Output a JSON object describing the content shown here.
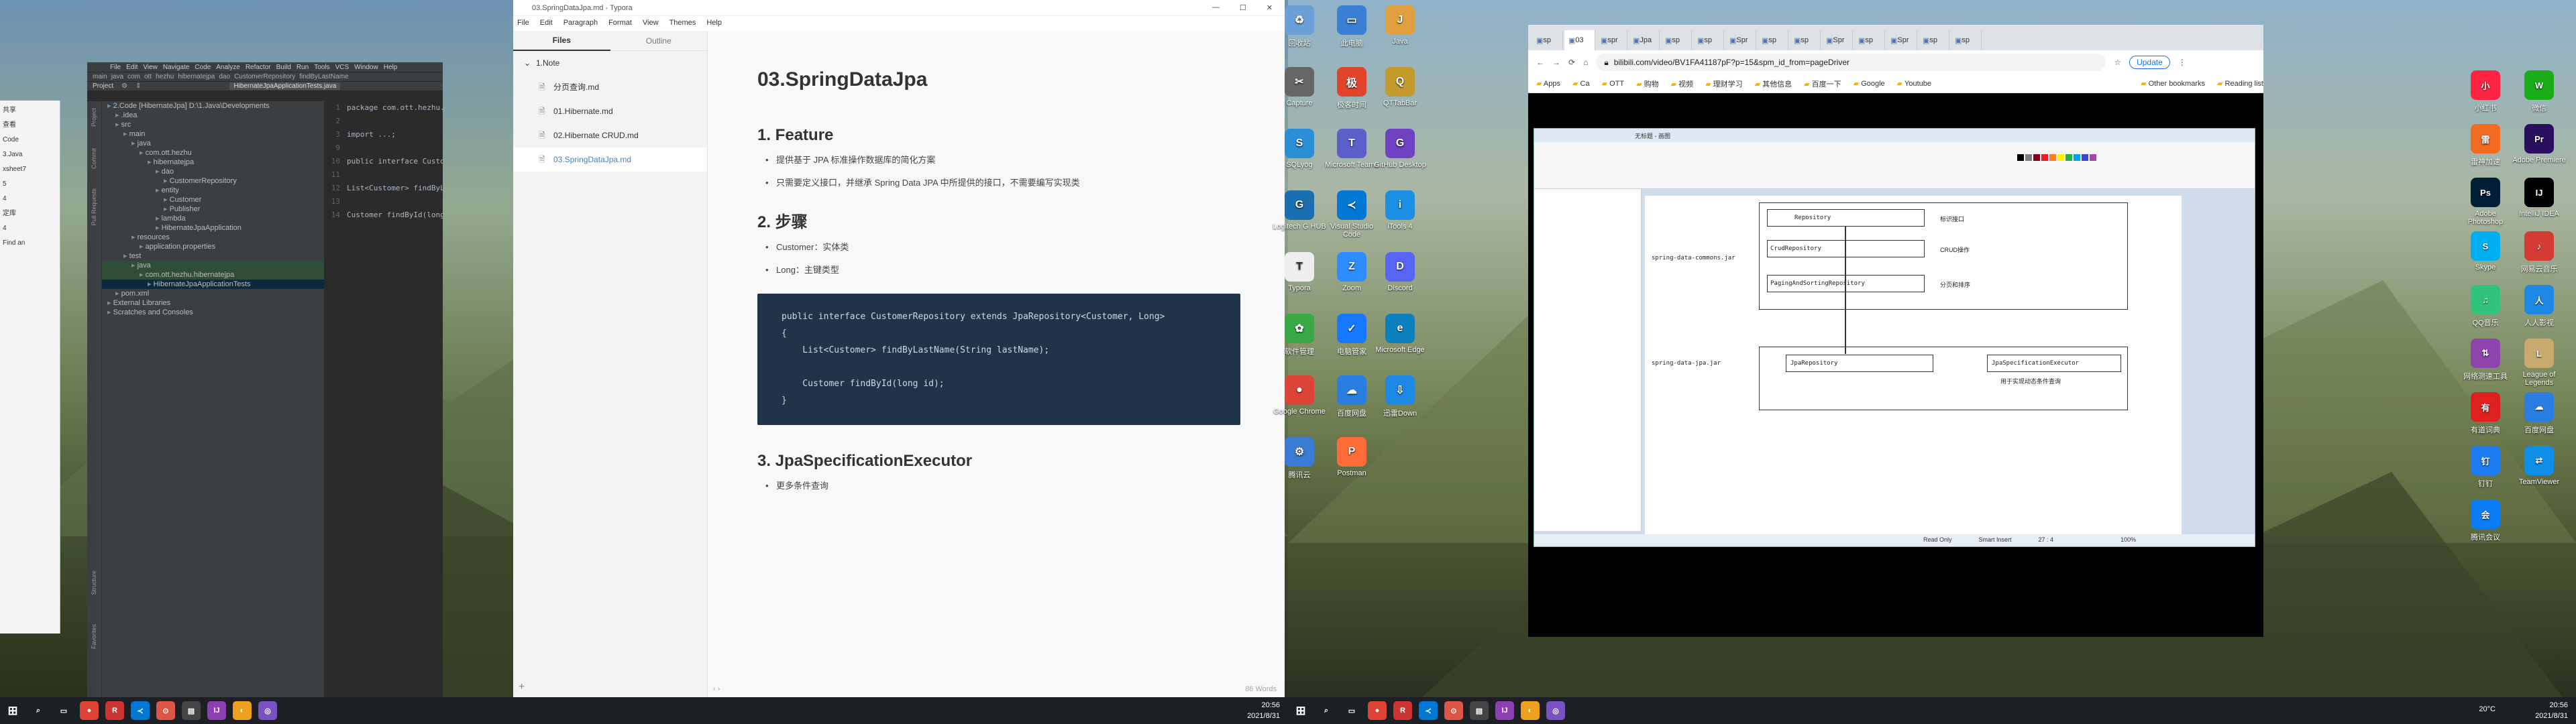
{
  "idea": {
    "menu": [
      "File",
      "Edit",
      "View",
      "Navigate",
      "Code",
      "Analyze",
      "Refactor",
      "Build",
      "Run",
      "Tools",
      "VCS",
      "Window",
      "Help"
    ],
    "navbar": [
      "main",
      "java",
      "com",
      "ott",
      "hezhu",
      "hibernatejpa",
      "dao",
      "CustomerRepository",
      "findByLastName"
    ],
    "tab": "HibernateJpaApplicationTests.java",
    "project_label": "Project",
    "tree": [
      {
        "label": "2.Code [HibernateJpa] D:\\1.Java\\Developments",
        "indent": 0
      },
      {
        "label": ".idea",
        "indent": 1
      },
      {
        "label": "src",
        "indent": 1
      },
      {
        "label": "main",
        "indent": 2
      },
      {
        "label": "java",
        "indent": 3
      },
      {
        "label": "com.ott.hezhu",
        "indent": 4
      },
      {
        "label": "hibernatejpa",
        "indent": 5
      },
      {
        "label": "dao",
        "indent": 6
      },
      {
        "label": "CustomerRepository",
        "indent": 7
      },
      {
        "label": "entity",
        "indent": 6
      },
      {
        "label": "Customer",
        "indent": 7
      },
      {
        "label": "Publisher",
        "indent": 7
      },
      {
        "label": "lambda",
        "indent": 6
      },
      {
        "label": "HibernateJpaApplication",
        "indent": 6
      },
      {
        "label": "resources",
        "indent": 3
      },
      {
        "label": "application.properties",
        "indent": 4
      },
      {
        "label": "test",
        "indent": 2
      },
      {
        "label": "java",
        "indent": 3
      },
      {
        "label": "com.ott.hezhu.hibernatejpa",
        "indent": 4
      },
      {
        "label": "HibernateJpaApplicationTests",
        "indent": 5
      },
      {
        "label": "pom.xml",
        "indent": 1
      },
      {
        "label": "External Libraries",
        "indent": 0
      },
      {
        "label": "Scratches and Consoles",
        "indent": 0
      }
    ],
    "code": [
      {
        "n": "1",
        "text": "package com.ott.hezhu.hibernatejpa.dao;"
      },
      {
        "n": "2",
        "text": ""
      },
      {
        "n": "3",
        "text": "import ...;"
      },
      {
        "n": "9",
        "text": ""
      },
      {
        "n": "10",
        "text": "public interface CustomerRepository"
      },
      {
        "n": "11",
        "text": ""
      },
      {
        "n": "12",
        "text": "    List<Customer> findByLastName"
      },
      {
        "n": "13",
        "text": ""
      },
      {
        "n": "14",
        "text": "    Customer findById(long id);"
      }
    ],
    "side_tabs": [
      "Project",
      "Commit",
      "Pull Requests"
    ],
    "bottom_tabs": [
      "Structure",
      "Favorites"
    ]
  },
  "behind": {
    "lines": [
      "共享",
      "查看",
      "Code",
      "3.Java",
      "xsheet7",
      "5",
      "4",
      "定库",
      "4",
      "Find an"
    ]
  },
  "typora": {
    "title": "03.SpringDataJpa.md - Typora",
    "menu": [
      "File",
      "Edit",
      "Paragraph",
      "Format",
      "View",
      "Themes",
      "Help"
    ],
    "side_tabs": [
      "Files",
      "Outline"
    ],
    "folder": "1.Note",
    "files": [
      "分页查询.md",
      "01.Hibernate.md",
      "02.Hibernate CRUD.md",
      "03.SpringDataJpa.md"
    ],
    "h1": "03.SpringDataJpa",
    "s1": "1. Feature",
    "s1_items": [
      "提供基于 JPA 标准操作数据库的简化方案",
      "只需要定义接口，并继承 Spring Data JPA 中所提供的接口，不需要编写实现类"
    ],
    "s2": "2. 步骤",
    "s2_items": [
      "Customer：实体类",
      "Long：主键类型"
    ],
    "code": [
      "public interface CustomerRepository extends JpaRepository<Customer, Long>",
      "{",
      "    List<Customer> findByLastName(String lastName);",
      "",
      "    Customer findById(long id);",
      "}"
    ],
    "s3": "3. JpaSpecificationExecutor",
    "s3_items": [
      "更多条件查询"
    ],
    "word_count": "86 Words"
  },
  "desktop_icons": [
    {
      "label": "回收站",
      "color": "#6aa0d8",
      "glyph": "♻"
    },
    {
      "label": "此电脑",
      "color": "#3b7fd4",
      "glyph": "▭"
    },
    {
      "label": "Java",
      "color": "#e0a040",
      "glyph": "J"
    },
    {
      "label": "Capture",
      "color": "#666",
      "glyph": "✂"
    },
    {
      "label": "极客时间",
      "color": "#e0452c",
      "glyph": "极"
    },
    {
      "label": "QTTabBar",
      "color": "#c49a2c",
      "glyph": "Q"
    },
    {
      "label": "SQLyog",
      "color": "#2b8fd6",
      "glyph": "S"
    },
    {
      "label": "Microsoft Teams",
      "color": "#5b5fc7",
      "glyph": "T"
    },
    {
      "label": "GitHub Desktop",
      "color": "#6f42c1",
      "glyph": "G"
    },
    {
      "label": "Logitech G HUB",
      "color": "#1a6fb0",
      "glyph": "G"
    },
    {
      "label": "Visual Studio Code",
      "color": "#0078d4",
      "glyph": "≺"
    },
    {
      "label": "iTools 4",
      "color": "#1a8fe3",
      "glyph": "i"
    },
    {
      "label": "Typora",
      "color": "#eee",
      "glyph": "T"
    },
    {
      "label": "Zoom",
      "color": "#2d8cff",
      "glyph": "Z"
    },
    {
      "label": "Discord",
      "color": "#5865f2",
      "glyph": "D"
    },
    {
      "label": "软件管理",
      "color": "#39a845",
      "glyph": "✿"
    },
    {
      "label": "电脑管家",
      "color": "#1677ff",
      "glyph": "✓"
    },
    {
      "label": "Microsoft Edge",
      "color": "#0c7fbd",
      "glyph": "e"
    },
    {
      "label": "Google Chrome",
      "color": "#db4437",
      "glyph": "●"
    },
    {
      "label": "百度网盘",
      "color": "#2a7de1",
      "glyph": "☁"
    },
    {
      "label": "迅雷Down",
      "color": "#1e88e5",
      "glyph": "⇩"
    },
    {
      "label": "腾讯云",
      "color": "#3a7bd5",
      "glyph": "⚙"
    },
    {
      "label": "Postman",
      "color": "#ff6c37",
      "glyph": "P"
    }
  ],
  "right_icons": [
    {
      "label": "小红书",
      "color": "#ff2442",
      "glyph": "小"
    },
    {
      "label": "微信",
      "color": "#1aad19",
      "glyph": "W"
    },
    {
      "label": "雷神加速",
      "color": "#f36b21",
      "glyph": "雷"
    },
    {
      "label": "Adobe Premiere",
      "color": "#2a0f5e",
      "glyph": "Pr"
    },
    {
      "label": "Adobe Photoshop",
      "color": "#001e36",
      "glyph": "Ps"
    },
    {
      "label": "IntelliJ IDEA",
      "color": "#000",
      "glyph": "IJ"
    },
    {
      "label": "Skype",
      "color": "#00aff0",
      "glyph": "S"
    },
    {
      "label": "网易云音乐",
      "color": "#d43c33",
      "glyph": "♪"
    },
    {
      "label": "QQ音乐",
      "color": "#31c27c",
      "glyph": "♫"
    },
    {
      "label": "人人影视",
      "color": "#1e88e5",
      "glyph": "人"
    },
    {
      "label": "网络测速工具",
      "color": "#8e44ad",
      "glyph": "⇅"
    },
    {
      "label": "League of Legends",
      "color": "#c8aa6e",
      "glyph": "L"
    },
    {
      "label": "有道词典",
      "color": "#e02020",
      "glyph": "有"
    },
    {
      "label": "百度网盘",
      "color": "#2a7de1",
      "glyph": "☁"
    },
    {
      "label": "钉钉",
      "color": "#1e7cf2",
      "glyph": "钉"
    },
    {
      "label": "TeamViewer",
      "color": "#0e8ee9",
      "glyph": "⇄"
    },
    {
      "label": "腾讯会议",
      "color": "#0a7cf5",
      "glyph": "会"
    }
  ],
  "chrome": {
    "tabs": [
      "sp",
      "03",
      "spr",
      "Jpa",
      "sp",
      "sp",
      "Spr",
      "sp",
      "sp",
      "Spr",
      "sp",
      "Spr",
      "sp",
      "sp"
    ],
    "url": "bilibili.com/video/BV1FA41187pF?p=15&spm_id_from=pageDriver",
    "update": "Update",
    "bookmarks": [
      "Apps",
      "Ca",
      "OTT",
      "购物",
      "视频",
      "理财学习",
      "其他信息",
      "百度一下",
      "Google",
      "Youtube",
      "Other bookmarks",
      "Reading list"
    ]
  },
  "video_diagram": {
    "window_title": "无标题 - 画图",
    "boxes": [
      "Repository",
      "CrudRepository",
      "PagingAndSortingRepository",
      "JpaRepository",
      "JpaSpecificationExecutor"
    ],
    "notes": [
      "标识接口",
      "CRUD操作",
      "分页和排序"
    ],
    "left_labels": [
      "spring-data-commons.jar",
      "spring-data-jpa.jar"
    ],
    "bottom_note": "用于实现动态条件查询",
    "status": [
      "Read Only",
      "Smart Insert",
      "27 : 4"
    ],
    "zoom": "100%"
  },
  "taskbar_left": {
    "time": "20:56",
    "date": "2021/8/31"
  },
  "taskbar_right": {
    "weather": "20°C",
    "time": "20:56",
    "date": "2021/8/31"
  }
}
